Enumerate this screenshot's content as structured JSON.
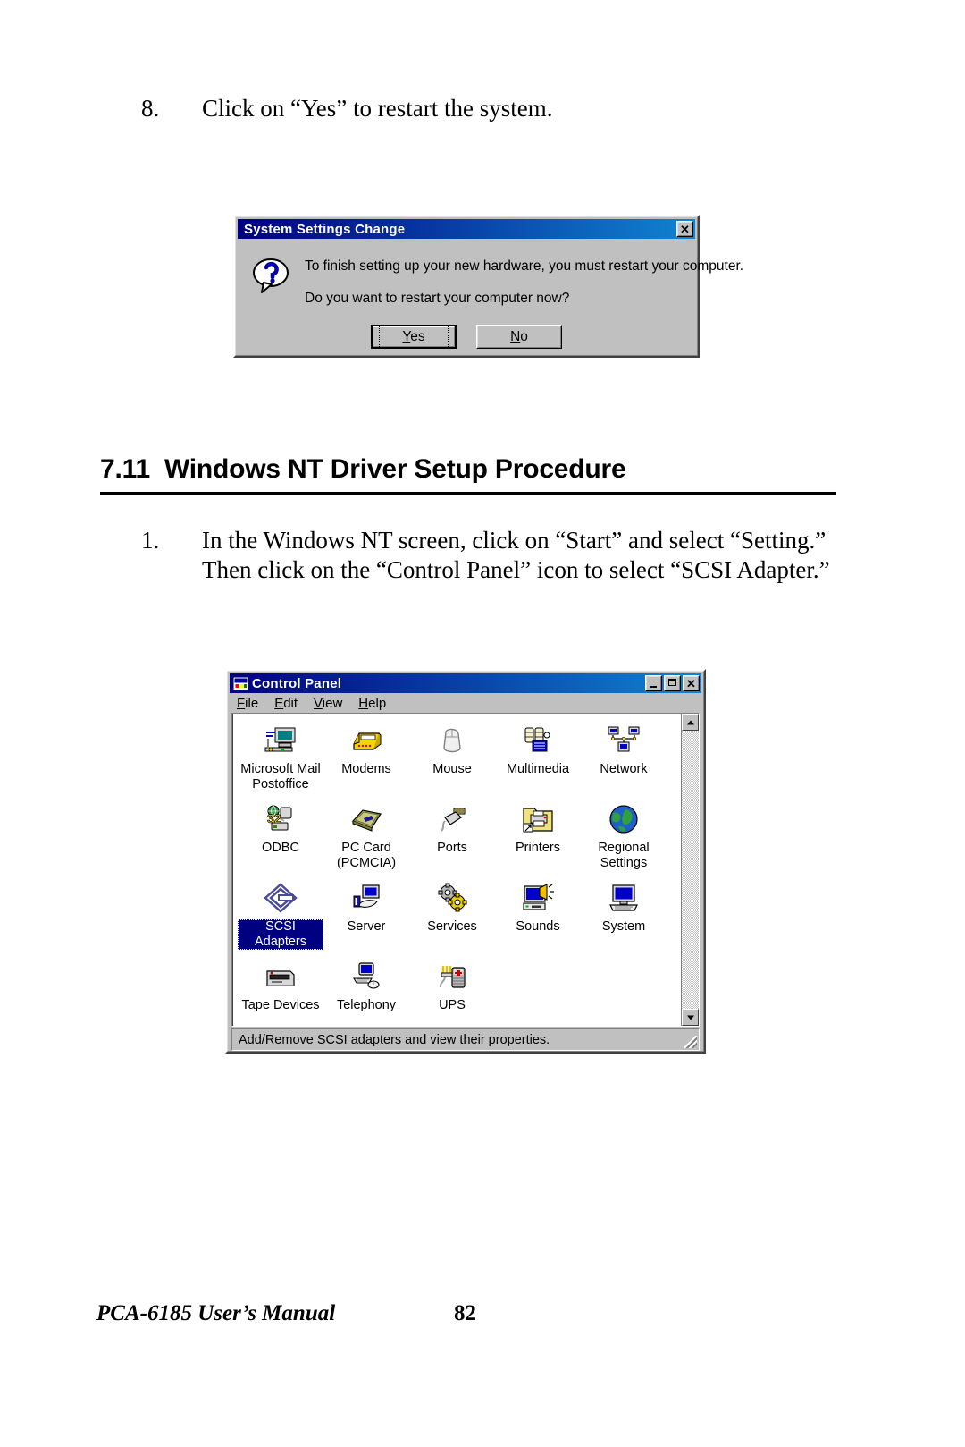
{
  "page": {
    "step8": {
      "number": "8.",
      "text": "Click on “Yes” to restart the system."
    },
    "section": {
      "number": "7.11",
      "title": "Windows NT Driver Setup Procedure"
    },
    "step1": {
      "number": "1.",
      "line1": "In the Windows NT screen, click on “Start” and select “Setting.”",
      "line2": "Then click on the “Control Panel” icon to select “SCSI Adapter.”"
    },
    "footer": {
      "manual": "PCA-6185 User’s Manual",
      "page_number": "82"
    }
  },
  "dialog": {
    "title": "System Settings Change",
    "icon": "question-icon",
    "close_label": "✕",
    "line1": "To finish setting up your new hardware, you must restart your computer.",
    "line2": "Do you want to restart your computer now?",
    "buttons": [
      {
        "label": "Yes",
        "accel": "Y",
        "default": true
      },
      {
        "label": "No",
        "accel": "N",
        "default": false
      }
    ]
  },
  "control_panel": {
    "title": "Control Panel",
    "title_icon": "control-panel-icon",
    "window_buttons": {
      "minimize": "minimize-icon",
      "maximize": "maximize-icon",
      "close": "✕"
    },
    "menu": [
      {
        "label": "File",
        "accel": "F"
      },
      {
        "label": "Edit",
        "accel": "E"
      },
      {
        "label": "View",
        "accel": "V"
      },
      {
        "label": "Help",
        "accel": "H"
      }
    ],
    "items": [
      {
        "label": "Microsoft Mail\nPostoffice",
        "icon": "mail-postoffice-icon",
        "selected": false
      },
      {
        "label": "Modems",
        "icon": "modem-icon",
        "selected": false
      },
      {
        "label": "Mouse",
        "icon": "mouse-icon",
        "selected": false
      },
      {
        "label": "Multimedia",
        "icon": "multimedia-icon",
        "selected": false
      },
      {
        "label": "Network",
        "icon": "network-icon",
        "selected": false
      },
      {
        "label": "ODBC",
        "icon": "odbc-icon",
        "selected": false
      },
      {
        "label": "PC Card\n(PCMCIA)",
        "icon": "pc-card-icon",
        "selected": false
      },
      {
        "label": "Ports",
        "icon": "ports-icon",
        "selected": false
      },
      {
        "label": "Printers",
        "icon": "printers-folder-icon",
        "selected": false
      },
      {
        "label": "Regional\nSettings",
        "icon": "globe-icon",
        "selected": false
      },
      {
        "label": "SCSI Adapters",
        "icon": "scsi-adapters-icon",
        "selected": true
      },
      {
        "label": "Server",
        "icon": "server-icon",
        "selected": false
      },
      {
        "label": "Services",
        "icon": "gears-icon",
        "selected": false
      },
      {
        "label": "Sounds",
        "icon": "sounds-icon",
        "selected": false
      },
      {
        "label": "System",
        "icon": "system-computer-icon",
        "selected": false
      },
      {
        "label": "Tape Devices",
        "icon": "tape-drive-icon",
        "selected": false
      },
      {
        "label": "Telephony",
        "icon": "telephony-icon",
        "selected": false
      },
      {
        "label": "UPS",
        "icon": "ups-battery-icon",
        "selected": false
      }
    ],
    "status_text": "Add/Remove SCSI adapters and view their properties.",
    "scrollbar": {
      "up": "scroll-up-icon",
      "down": "scroll-down-icon"
    }
  },
  "colors": {
    "title_active_left": "#000080",
    "title_active_right": "#1084d0",
    "face": "#c0c0c0",
    "selection": "#000080"
  }
}
